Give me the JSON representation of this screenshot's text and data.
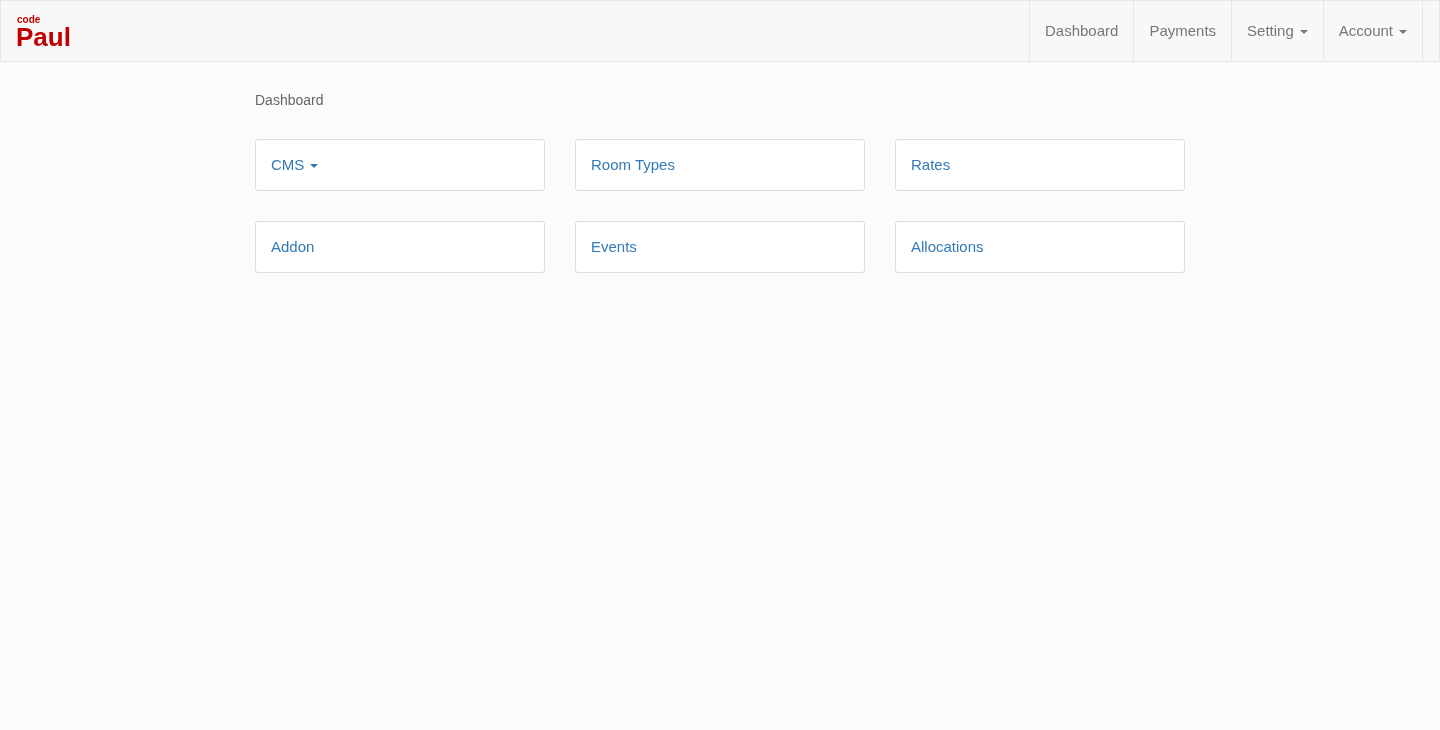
{
  "logo": {
    "small": "code",
    "large": "Paul"
  },
  "nav": [
    {
      "label": "Dashboard",
      "dropdown": false
    },
    {
      "label": "Payments",
      "dropdown": false
    },
    {
      "label": "Setting",
      "dropdown": true
    },
    {
      "label": "Account",
      "dropdown": true
    }
  ],
  "breadcrumb": "Dashboard",
  "tiles": [
    {
      "label": "CMS",
      "dropdown": true
    },
    {
      "label": "Room Types",
      "dropdown": false
    },
    {
      "label": "Rates",
      "dropdown": false
    },
    {
      "label": "Addon",
      "dropdown": false
    },
    {
      "label": "Events",
      "dropdown": false
    },
    {
      "label": "Allocations",
      "dropdown": false
    }
  ]
}
